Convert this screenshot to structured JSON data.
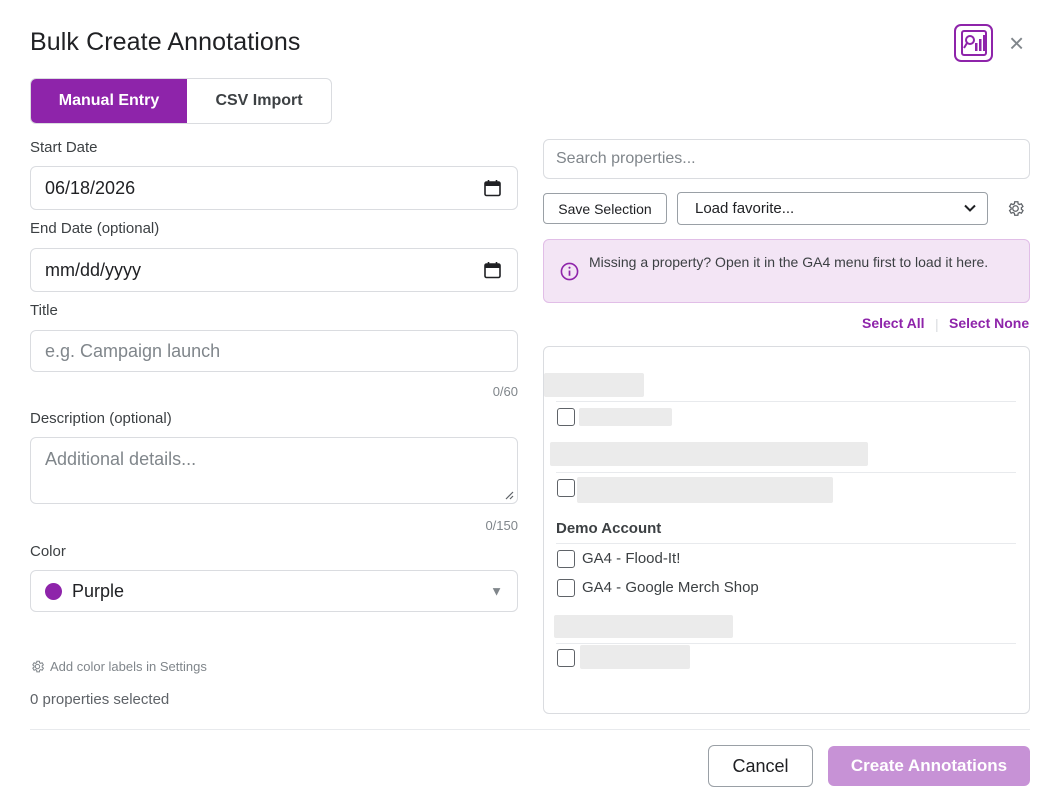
{
  "dialog": {
    "title": "Bulk Create Annotations"
  },
  "tabs": [
    {
      "label": "Manual Entry",
      "active": true
    },
    {
      "label": "CSV Import",
      "active": false
    }
  ],
  "form": {
    "start_date": {
      "label": "Start Date",
      "value": "06/18/2026"
    },
    "end_date": {
      "label": "End Date (optional)",
      "placeholder": "mm/dd/yyyy"
    },
    "title": {
      "label": "Title",
      "placeholder": "e.g. Campaign launch",
      "counter": "0/60"
    },
    "description": {
      "label": "Description (optional)",
      "placeholder": "Additional details...",
      "counter": "0/150"
    },
    "color": {
      "label": "Color",
      "value": "Purple",
      "swatch": "#8e24aa"
    },
    "settings_link": "Add color labels in Settings",
    "selected_count": "0 properties selected"
  },
  "properties": {
    "search_placeholder": "Search properties...",
    "save_selection": "Save Selection",
    "load_favorite": "Load favorite...",
    "info": "Missing a property? Open it in the GA4 menu first to load it here.",
    "select_all": "Select All",
    "select_none": "Select None",
    "groups": [
      {
        "name": "Demo Account",
        "items": [
          "GA4 - Flood-It!",
          "GA4 - Google Merch Shop"
        ]
      }
    ]
  },
  "footer": {
    "cancel": "Cancel",
    "create": "Create Annotations"
  },
  "colors": {
    "accent": "#8e24aa",
    "accent_disabled": "#c792d6"
  }
}
